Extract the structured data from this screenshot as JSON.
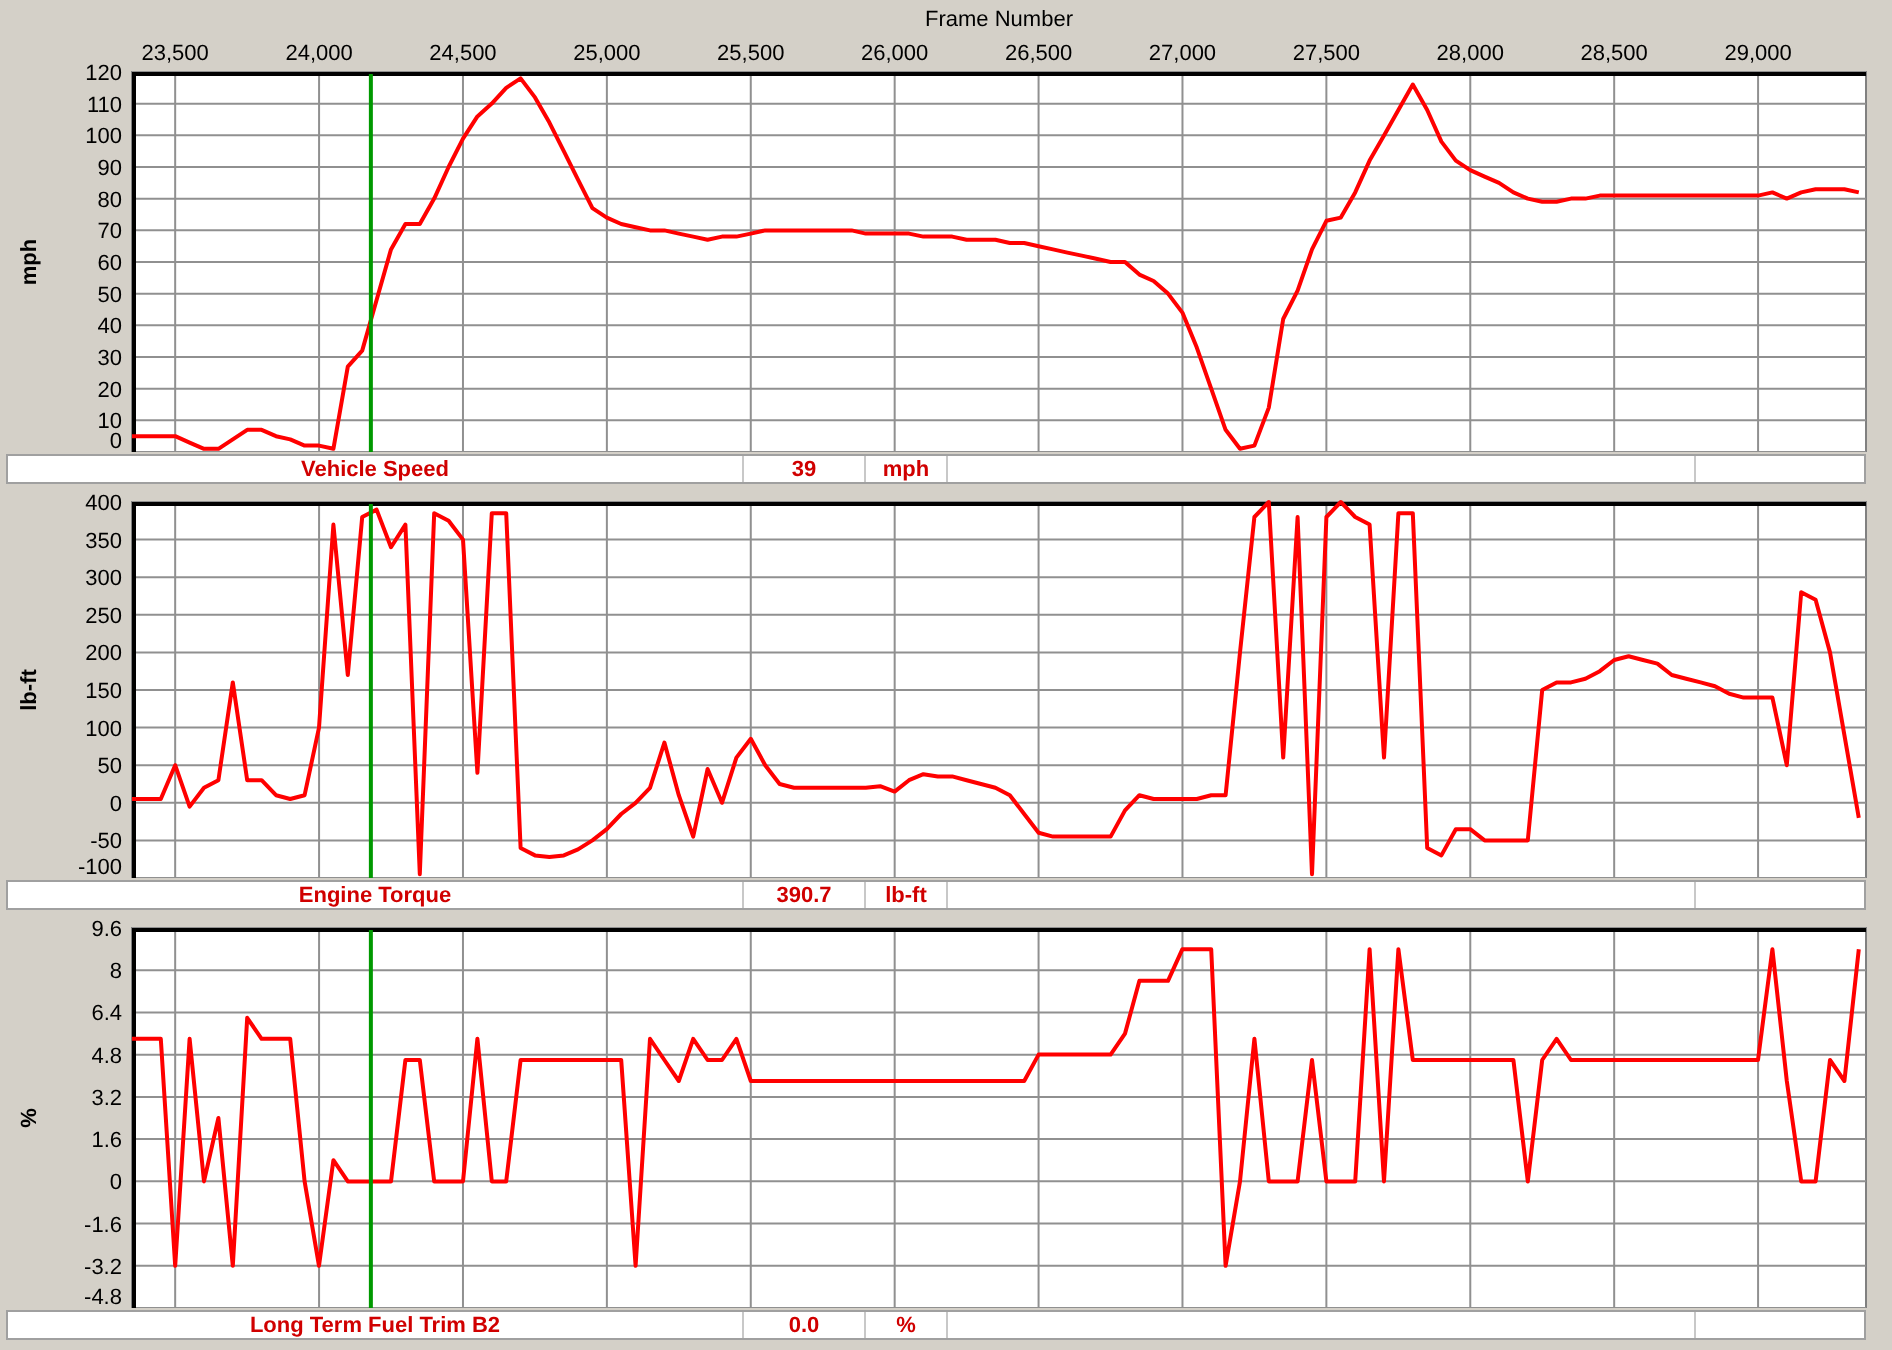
{
  "panels": [
    {
      "chart_data": {
        "type": "line",
        "xlabel": "Frame Number",
        "ylabel": "mph",
        "xlim": [
          23350,
          29375
        ],
        "ylim": [
          0,
          120
        ],
        "xticks": [
          {
            "value": 23500,
            "label": "23,500"
          },
          {
            "value": 24000,
            "label": "24,000"
          },
          {
            "value": 24500,
            "label": "24,500"
          },
          {
            "value": 25000,
            "label": "25,000"
          },
          {
            "value": 25500,
            "label": "25,500"
          },
          {
            "value": 26000,
            "label": "26,000"
          },
          {
            "value": 26500,
            "label": "26,500"
          },
          {
            "value": 27000,
            "label": "27,000"
          },
          {
            "value": 27500,
            "label": "27,500"
          },
          {
            "value": 28000,
            "label": "28,000"
          },
          {
            "value": 28500,
            "label": "28,500"
          },
          {
            "value": 29000,
            "label": "29,000"
          }
        ],
        "yticks": [
          0,
          10,
          20,
          30,
          40,
          50,
          60,
          70,
          80,
          90,
          100,
          110,
          120
        ],
        "x": [
          23350,
          23400,
          23450,
          23500,
          23550,
          23600,
          23650,
          23700,
          23750,
          23800,
          23850,
          23900,
          23950,
          24000,
          24050,
          24100,
          24150,
          24200,
          24250,
          24300,
          24350,
          24400,
          24450,
          24500,
          24550,
          24600,
          24650,
          24700,
          24750,
          24800,
          24850,
          24900,
          24950,
          25000,
          25050,
          25100,
          25150,
          25200,
          25250,
          25300,
          25350,
          25400,
          25450,
          25500,
          25550,
          25600,
          25650,
          25700,
          25750,
          25800,
          25850,
          25900,
          25950,
          26000,
          26050,
          26100,
          26150,
          26200,
          26250,
          26300,
          26350,
          26400,
          26450,
          26500,
          26550,
          26600,
          26650,
          26700,
          26750,
          26800,
          26850,
          26900,
          26950,
          27000,
          27050,
          27100,
          27150,
          27200,
          27250,
          27300,
          27350,
          27400,
          27450,
          27500,
          27550,
          27600,
          27650,
          27700,
          27750,
          27800,
          27850,
          27900,
          27950,
          28000,
          28050,
          28100,
          28150,
          28200,
          28250,
          28300,
          28350,
          28400,
          28450,
          28500,
          28550,
          28600,
          28650,
          28700,
          28750,
          28800,
          28850,
          28900,
          28950,
          29000,
          29050,
          29100,
          29150,
          29200,
          29250,
          29300,
          29350
        ],
        "series": [
          {
            "name": "Vehicle Speed",
            "color": "#ff0000",
            "values": [
              5,
              5,
              5,
              5,
              3,
              1,
              1,
              4,
              7,
              7,
              5,
              4,
              2,
              2,
              1,
              27,
              32,
              48,
              64,
              72,
              72,
              80,
              90,
              99,
              106,
              110,
              115,
              118,
              112,
              104,
              95,
              86,
              77,
              74,
              72,
              71,
              70,
              70,
              69,
              68,
              67,
              68,
              68,
              69,
              70,
              70,
              70,
              70,
              70,
              70,
              70,
              69,
              69,
              69,
              69,
              68,
              68,
              68,
              67,
              67,
              67,
              66,
              66,
              65,
              64,
              63,
              62,
              61,
              60,
              60,
              56,
              54,
              50,
              44,
              33,
              20,
              7,
              1,
              2,
              14,
              42,
              51,
              64,
              73,
              74,
              82,
              92,
              100,
              108,
              116,
              108,
              98,
              92,
              89,
              87,
              85,
              82,
              80,
              79,
              79,
              80,
              80,
              81,
              81,
              81,
              81,
              81,
              81,
              81,
              81,
              81,
              81,
              81,
              81,
              82,
              80,
              82,
              83,
              83,
              83,
              82
            ]
          }
        ],
        "grid": true,
        "ref_lines": [
          {
            "axis": "x",
            "value": 24180,
            "color": "#009900"
          }
        ]
      },
      "legend": {
        "value": "39",
        "unit": "mph"
      }
    },
    {
      "chart_data": {
        "type": "line",
        "ylabel": "lb-ft",
        "xlim": [
          23350,
          29375
        ],
        "ylim": [
          -100,
          400
        ],
        "yticks": [
          -100,
          -50,
          0,
          50,
          100,
          150,
          200,
          250,
          300,
          350,
          400
        ],
        "x": [
          23350,
          23400,
          23450,
          23500,
          23550,
          23600,
          23650,
          23700,
          23750,
          23800,
          23850,
          23900,
          23950,
          24000,
          24050,
          24100,
          24150,
          24200,
          24250,
          24300,
          24350,
          24400,
          24450,
          24500,
          24550,
          24600,
          24650,
          24700,
          24750,
          24800,
          24850,
          24900,
          24950,
          25000,
          25050,
          25100,
          25150,
          25200,
          25250,
          25300,
          25350,
          25400,
          25450,
          25500,
          25550,
          25600,
          25650,
          25700,
          25750,
          25800,
          25850,
          25900,
          25950,
          26000,
          26050,
          26100,
          26150,
          26200,
          26250,
          26300,
          26350,
          26400,
          26450,
          26500,
          26550,
          26600,
          26650,
          26700,
          26750,
          26800,
          26850,
          26900,
          26950,
          27000,
          27050,
          27100,
          27150,
          27200,
          27250,
          27300,
          27350,
          27400,
          27450,
          27500,
          27550,
          27600,
          27650,
          27700,
          27750,
          27800,
          27850,
          27900,
          27950,
          28000,
          28050,
          28100,
          28150,
          28200,
          28250,
          28300,
          28350,
          28400,
          28450,
          28500,
          28550,
          28600,
          28650,
          28700,
          28750,
          28800,
          28850,
          28900,
          28950,
          29000,
          29050,
          29100,
          29150,
          29200,
          29250,
          29300,
          29350
        ],
        "series": [
          {
            "name": "Engine Torque",
            "color": "#ff0000",
            "values": [
              5,
              5,
              5,
              50,
              -5,
              20,
              30,
              160,
              30,
              30,
              10,
              5,
              10,
              100,
              370,
              170,
              380,
              390,
              340,
              370,
              -95,
              385,
              375,
              350,
              40,
              385,
              385,
              -60,
              -70,
              -72,
              -70,
              -62,
              -50,
              -35,
              -15,
              0,
              20,
              80,
              10,
              -45,
              45,
              0,
              60,
              85,
              50,
              25,
              20,
              20,
              20,
              20,
              20,
              20,
              22,
              15,
              30,
              38,
              35,
              35,
              30,
              25,
              20,
              10,
              -15,
              -40,
              -45,
              -45,
              -45,
              -45,
              -45,
              -10,
              10,
              5,
              5,
              5,
              5,
              10,
              10,
              200,
              380,
              400,
              60,
              380,
              -95,
              380,
              400,
              380,
              370,
              60,
              385,
              385,
              -60,
              -70,
              -35,
              -35,
              -50,
              -50,
              -50,
              -50,
              150,
              160,
              160,
              165,
              175,
              190,
              195,
              190,
              185,
              170,
              165,
              160,
              155,
              145,
              140,
              140,
              140,
              50,
              280,
              270,
              200,
              90,
              -20
            ]
          }
        ],
        "grid": true,
        "ref_lines": [
          {
            "axis": "x",
            "value": 24180,
            "color": "#009900"
          }
        ]
      },
      "legend": {
        "value": "390.7",
        "unit": "lb-ft"
      }
    },
    {
      "chart_data": {
        "type": "line",
        "ylabel": "%",
        "xlim": [
          23350,
          29375
        ],
        "ylim": [
          -4.8,
          9.6
        ],
        "yticks": [
          -4.8,
          -3.2,
          -1.6,
          0,
          1.6,
          3.2,
          4.8,
          6.4,
          8,
          9.6
        ],
        "x": [
          23350,
          23400,
          23450,
          23500,
          23550,
          23600,
          23650,
          23700,
          23750,
          23800,
          23850,
          23900,
          23950,
          24000,
          24050,
          24100,
          24150,
          24200,
          24250,
          24300,
          24350,
          24400,
          24450,
          24500,
          24550,
          24600,
          24650,
          24700,
          24750,
          24800,
          24850,
          24900,
          24950,
          25000,
          25050,
          25100,
          25150,
          25200,
          25250,
          25300,
          25350,
          25400,
          25450,
          25500,
          25550,
          25600,
          25650,
          25700,
          25750,
          25800,
          25850,
          25900,
          25950,
          26000,
          26050,
          26100,
          26150,
          26200,
          26250,
          26300,
          26350,
          26400,
          26450,
          26500,
          26550,
          26600,
          26650,
          26700,
          26750,
          26800,
          26850,
          26900,
          26950,
          27000,
          27050,
          27100,
          27150,
          27200,
          27250,
          27300,
          27350,
          27400,
          27450,
          27500,
          27550,
          27600,
          27650,
          27700,
          27750,
          27800,
          27850,
          27900,
          27950,
          28000,
          28050,
          28100,
          28150,
          28200,
          28250,
          28300,
          28350,
          28400,
          28450,
          28500,
          28550,
          28600,
          28650,
          28700,
          28750,
          28800,
          28850,
          28900,
          28950,
          29000,
          29050,
          29100,
          29150,
          29200,
          29250,
          29300,
          29350
        ],
        "series": [
          {
            "name": "Long Term Fuel Trim B2",
            "color": "#ff0000",
            "values": [
              5.4,
              5.4,
              5.4,
              -3.2,
              5.4,
              0,
              2.4,
              -3.2,
              6.2,
              5.4,
              5.4,
              5.4,
              0,
              -3.2,
              0.8,
              0,
              0,
              0,
              0,
              4.6,
              4.6,
              0,
              0,
              0,
              5.4,
              0,
              0,
              4.6,
              4.6,
              4.6,
              4.6,
              4.6,
              4.6,
              4.6,
              4.6,
              -3.2,
              5.4,
              4.6,
              3.8,
              5.4,
              4.6,
              4.6,
              5.4,
              3.8,
              3.8,
              3.8,
              3.8,
              3.8,
              3.8,
              3.8,
              3.8,
              3.8,
              3.8,
              3.8,
              3.8,
              3.8,
              3.8,
              3.8,
              3.8,
              3.8,
              3.8,
              3.8,
              3.8,
              4.8,
              4.8,
              4.8,
              4.8,
              4.8,
              4.8,
              5.6,
              7.6,
              7.6,
              7.6,
              8.8,
              8.8,
              8.8,
              -3.2,
              0,
              5.4,
              0,
              0,
              0,
              4.6,
              0,
              0,
              0,
              8.8,
              0,
              8.8,
              4.6,
              4.6,
              4.6,
              4.6,
              4.6,
              4.6,
              4.6,
              4.6,
              0,
              4.6,
              5.4,
              4.6,
              4.6,
              4.6,
              4.6,
              4.6,
              4.6,
              4.6,
              4.6,
              4.6,
              4.6,
              4.6,
              4.6,
              4.6,
              4.6,
              8.8,
              3.8,
              0,
              0,
              4.6,
              3.8,
              8.8
            ]
          }
        ],
        "grid": true,
        "ref_lines": [
          {
            "axis": "x",
            "value": 24180,
            "color": "#009900"
          }
        ]
      },
      "legend": {
        "value": "0.0",
        "unit": "%"
      }
    }
  ]
}
